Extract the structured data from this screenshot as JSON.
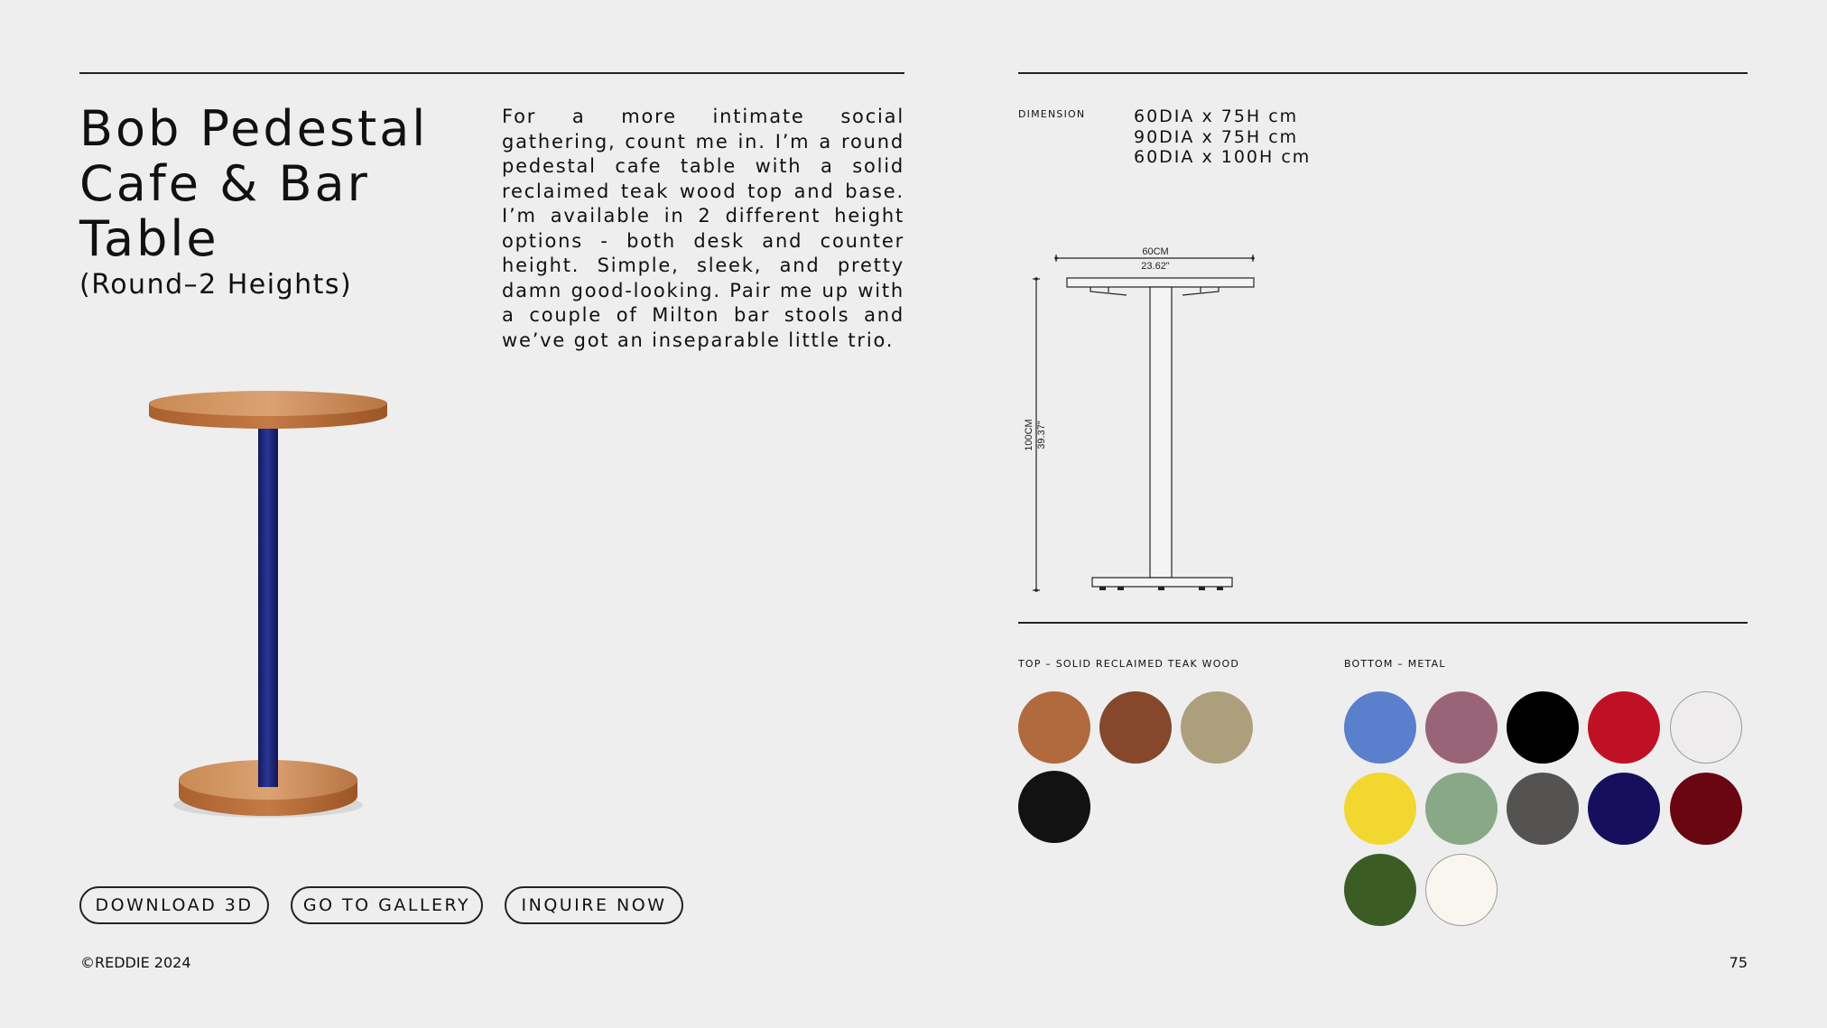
{
  "product": {
    "title": "Bob Pedestal Cafe & Bar Table",
    "subtitle": "(Round–2 Heights)",
    "description": "For a more intimate social gathering, count me in. I’m a round pedestal cafe table with a solid reclaimed teak wood top and base. I’m available in 2 different height options -  both desk and counter height. Simple, sleek, and pretty damn good-looking. Pair me up with a couple of Milton bar stools and we’ve got an inseparable little trio."
  },
  "buttons": {
    "download_3d": "DOWNLOAD 3D",
    "go_to_gallery": "GO TO GALLERY",
    "inquire_now": "INQUIRE NOW"
  },
  "dimensions": {
    "label": "DIMENSION",
    "options": [
      "60DIA x 75H cm",
      "90DIA x 75H cm",
      "60DIA x 100H cm"
    ],
    "drawing": {
      "width_cm": "60CM",
      "width_in": "23.62\"",
      "height_cm": "100CM",
      "height_in": "39.37\""
    }
  },
  "finishes": {
    "top": {
      "label": "TOP – SOLID RECLAIMED TEAK WOOD",
      "swatches": [
        {
          "name": "natural-teak",
          "color": "#b06a3e"
        },
        {
          "name": "dark-teak",
          "color": "#85482a"
        },
        {
          "name": "weathered-teak",
          "color": "#ad9f7c"
        },
        {
          "name": "black-teak",
          "color": "#121212"
        }
      ]
    },
    "bottom": {
      "label": "BOTTOM – METAL",
      "swatches": [
        {
          "name": "blue",
          "color": "#5a7fcc"
        },
        {
          "name": "mauve",
          "color": "#9a6478"
        },
        {
          "name": "black",
          "color": "#000000"
        },
        {
          "name": "red",
          "color": "#c01124"
        },
        {
          "name": "light-grey",
          "color": "#eeecec",
          "outlined": true
        },
        {
          "name": "yellow",
          "color": "#f1d72f"
        },
        {
          "name": "sage-green",
          "color": "#89a887"
        },
        {
          "name": "charcoal",
          "color": "#555352"
        },
        {
          "name": "navy",
          "color": "#170f5d"
        },
        {
          "name": "burgundy",
          "color": "#690611"
        },
        {
          "name": "forest-green",
          "color": "#3b5d24"
        },
        {
          "name": "cream",
          "color": "#f8f6ef",
          "outlined": true
        }
      ]
    }
  },
  "footer": {
    "copyright": "©REDDIE 2024",
    "page_number": "75"
  }
}
